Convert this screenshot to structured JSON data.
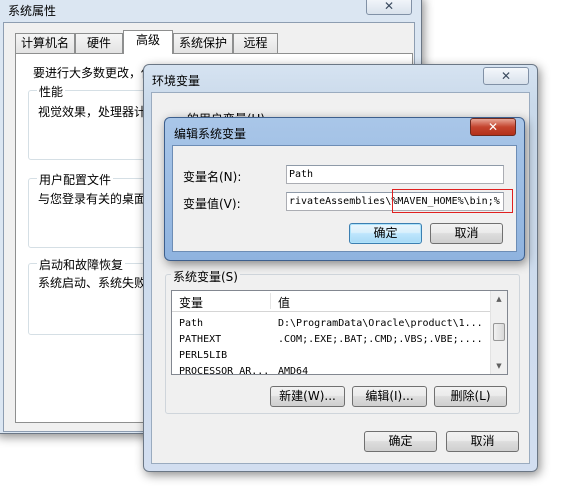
{
  "sysprops": {
    "title": "系统属性",
    "tabs": [
      "计算机名",
      "硬件",
      "高级",
      "系统保护",
      "远程"
    ],
    "intro": "要进行大多数更改，你",
    "perf_title": "性能",
    "perf_desc": "视觉效果，处理器计",
    "profile_title": "用户配置文件",
    "profile_desc": "与您登录有关的桌面",
    "startup_title": "启动和故障恢复",
    "startup_desc": "系统启动、系统失败"
  },
  "envvars": {
    "title": "环境变量",
    "user_section_partial": "… 的用户变量(U)",
    "system_section": "系统变量(S)",
    "columns": [
      "变量",
      "值"
    ],
    "rows": [
      {
        "name": "Path",
        "value": "D:\\ProgramData\\Oracle\\product\\1..."
      },
      {
        "name": "PATHEXT",
        "value": ".COM;.EXE;.BAT;.CMD;.VBS;.VBE;...."
      },
      {
        "name": "PERL5LIB",
        "value": ""
      },
      {
        "name": "PROCESSOR_AR...",
        "value": "AMD64"
      }
    ],
    "new_button": "新建(W)...",
    "edit_button": "编辑(I)...",
    "delete_button": "删除(L)",
    "ok_button": "确定",
    "cancel_button": "取消"
  },
  "editvar": {
    "title": "编辑系统变量",
    "name_label": "变量名(N):",
    "name_value": "Path",
    "value_label": "变量值(V):",
    "value_prefix": "rivateAssemblies\\",
    "value_highlight": "%MAVEN_HOME%\\bin;%",
    "ok_button": "确定",
    "cancel_button": "取消",
    "highlight_color": "#e02020"
  }
}
